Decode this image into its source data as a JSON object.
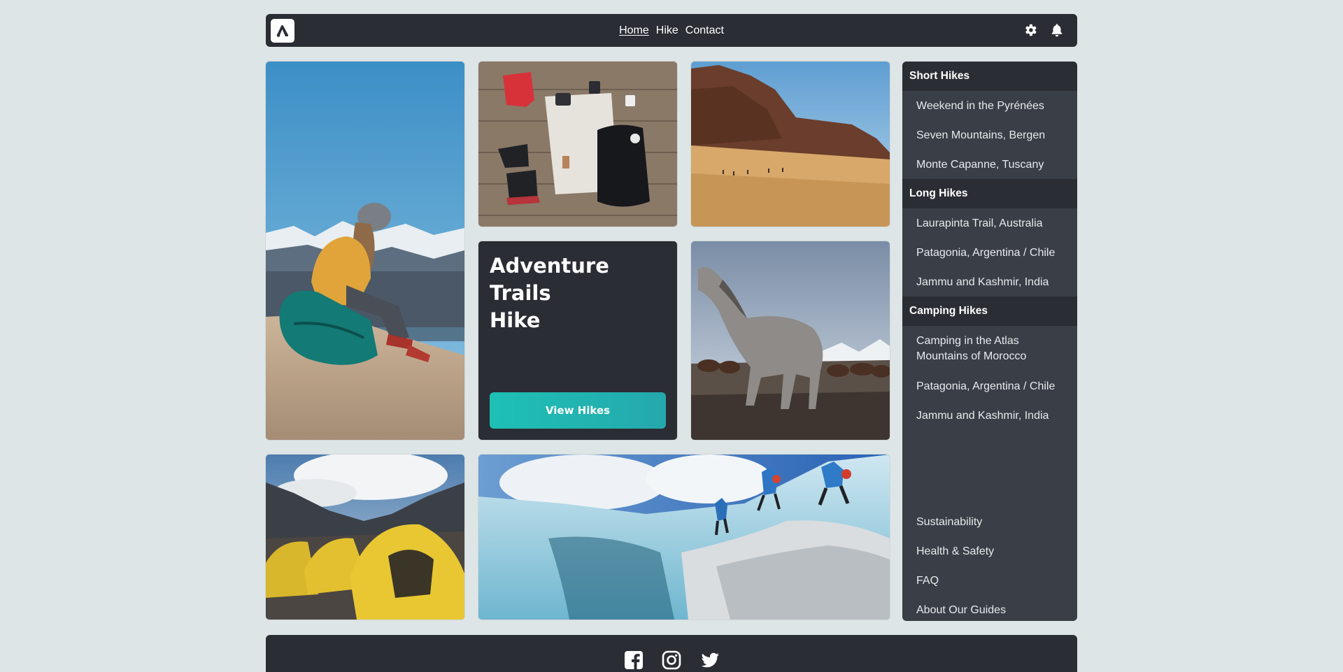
{
  "nav": {
    "links": [
      "Home",
      "Hike",
      "Contact"
    ],
    "active": "Home"
  },
  "header_icons": [
    "gear-icon",
    "bell-icon"
  ],
  "hero": {
    "title_lines": [
      "Adventure",
      "Trails",
      "Hike"
    ],
    "button_label": "View Hikes"
  },
  "sidebar": {
    "sections": [
      {
        "heading": "Short Hikes",
        "items": [
          "Weekend in the Pyrénées",
          "Seven Mountains, Bergen",
          "Monte Capanne, Tuscany"
        ]
      },
      {
        "heading": "Long Hikes",
        "items": [
          "Laurapinta Trail, Australia",
          "Patagonia, Argentina / Chile",
          "Jammu and Kashmir, India"
        ]
      },
      {
        "heading": "Camping Hikes",
        "items": [
          "Camping in the Atlas Mountains of Morocco",
          "Patagonia, Argentina / Chile",
          "Jammu and Kashmir, India"
        ]
      }
    ],
    "footer_links": [
      "Sustainability",
      "Health & Safety",
      "FAQ",
      "About Our Guides"
    ]
  },
  "social_icons": [
    "facebook-icon",
    "instagram-icon",
    "twitter-icon"
  ],
  "colors": {
    "page_bg": "#dde5e6",
    "dark": "#2a2d33",
    "sidebar_bg": "#3a3e46",
    "accent": "#1ec0b4"
  }
}
